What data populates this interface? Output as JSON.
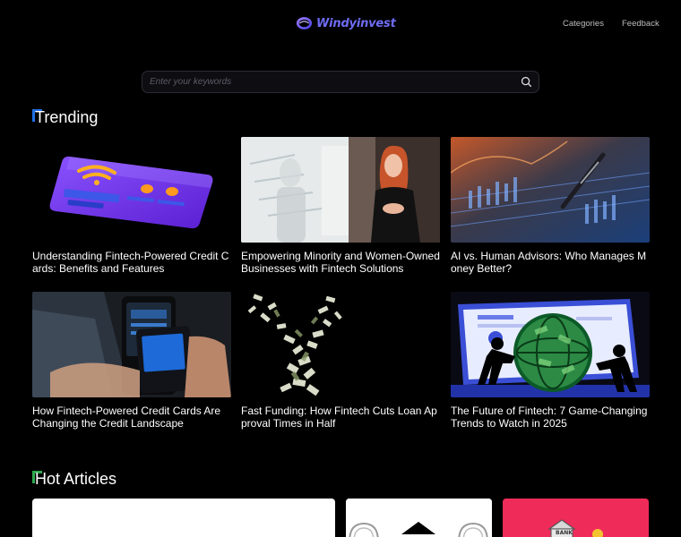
{
  "header": {
    "logo_text": "Windyinvest",
    "nav": [
      {
        "label": "Categories"
      },
      {
        "label": "Feedback"
      }
    ]
  },
  "search": {
    "placeholder": "Enter your keywords",
    "value": ""
  },
  "trending": {
    "title": "Trending",
    "articles": [
      {
        "title": "Understanding Fintech-Powered Credit Cards: Benefits and Features",
        "image": "purple-credit-card-3d"
      },
      {
        "title": "Empowering Minority and Women-Owned Businesses with Fintech Solutions",
        "image": "woman-presenting-whiteboard"
      },
      {
        "title": "AI vs. Human Advisors: Who Manages Money Better?",
        "image": "pen-on-financial-charts"
      },
      {
        "title": "How Fintech-Powered Credit Cards Are Changing the Credit Landscape",
        "image": "phone-payment-terminal"
      },
      {
        "title": "Fast Funding: How Fintech Cuts Loan Approval Times in Half",
        "image": "money-tornado"
      },
      {
        "title": "The Future of Fintech: 7 Game-Changing Trends to Watch in 2025",
        "image": "people-pushing-money-globe"
      }
    ]
  },
  "hot_articles": {
    "title": "Hot Articles",
    "bank_sign": "BANK"
  },
  "colors": {
    "accent": "#6f6cf5",
    "trending_marker": "#1f6fe5",
    "hot_marker": "#2fa84f",
    "hot_card_pink": "#ef2b5a"
  }
}
